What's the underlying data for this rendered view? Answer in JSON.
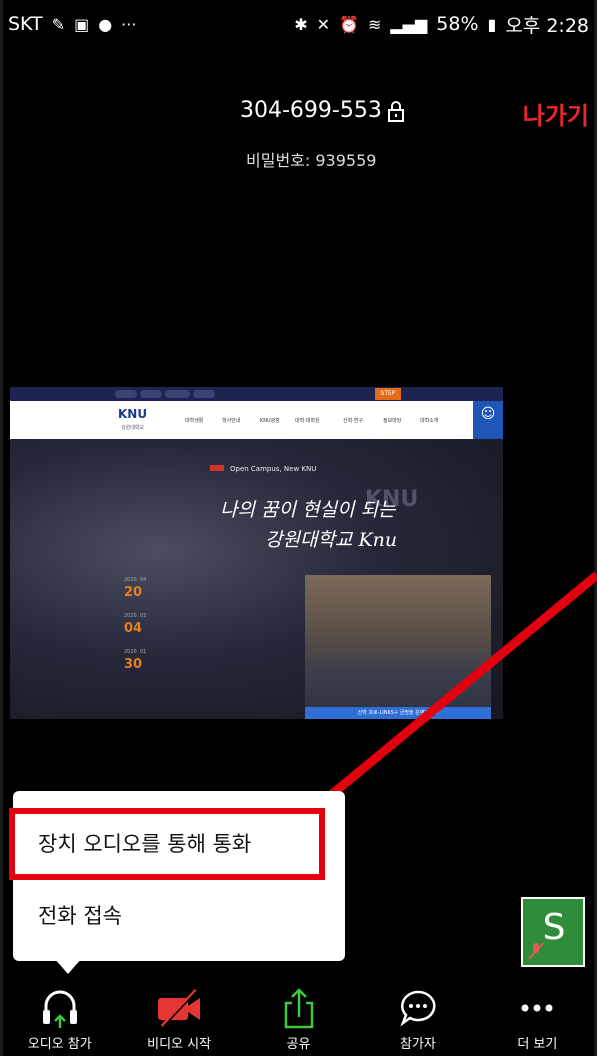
{
  "status_bar": {
    "carrier": "SKT",
    "battery": "58%",
    "time": "오후 2:28",
    "icons": [
      "pencil-icon",
      "image-icon",
      "chat-icon",
      "more-icon",
      "bluetooth-icon",
      "mute-icon",
      "alarm-icon",
      "wifi-icon",
      "signal-icon",
      "battery-icon"
    ]
  },
  "meeting": {
    "id": "304-699-553",
    "password_label": "비밀번호: 939559",
    "leave_label": "나가기",
    "leave_color": "#e8282b"
  },
  "shared_screen": {
    "logo": "KNU",
    "logo_sub": "강원대학교",
    "menu_items": [
      "대학생활",
      "학사안내",
      "KNU광장",
      "대학·대학원",
      "산학·연구",
      "정보마당",
      "대학소개"
    ],
    "open_campus": "Open Campus, New KNU",
    "slogan_line1": "나의 꿈이 현실이 되는",
    "slogan_line2": "강원대학교 Knu",
    "watermark": "KNU",
    "dates": [
      {
        "day": "20",
        "small": "2020. 04"
      },
      {
        "day": "04",
        "small": "2020. 02"
      },
      {
        "day": "30",
        "small": "2020. 01"
      }
    ],
    "photo_caption": "산학 프로-LINKS+ 금명을 운영하면..."
  },
  "audio_popup": {
    "option_device": "장치 오디오를 통해 통화",
    "option_phone": "전화 접속"
  },
  "self_view": {
    "initial": "S",
    "bg_color": "#2f8c3a"
  },
  "toolbar": {
    "items": [
      {
        "label": "오디오 참가",
        "icon": "headphones-icon"
      },
      {
        "label": "비디오 시작",
        "icon": "video-off-icon"
      },
      {
        "label": "공유",
        "icon": "share-icon"
      },
      {
        "label": "참가자",
        "icon": "chat-bubble-icon"
      },
      {
        "label": "더 보기",
        "icon": "more-icon"
      }
    ]
  },
  "annotation_color": "#e3000f"
}
